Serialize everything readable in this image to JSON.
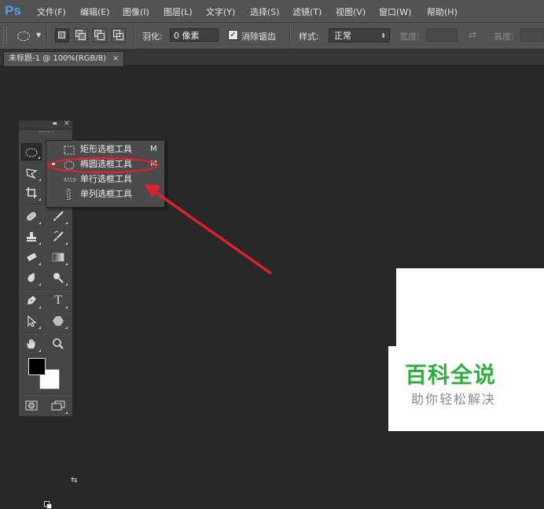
{
  "app": {
    "logo": "Ps"
  },
  "menubar": {
    "items": [
      "文件(F)",
      "编辑(E)",
      "图像(I)",
      "图层(L)",
      "文字(Y)",
      "选择(S)",
      "滤镜(T)",
      "视图(V)",
      "窗口(W)",
      "帮助(H)"
    ]
  },
  "options_bar": {
    "current_tool_icon": "elliptical-marquee-icon",
    "feather_label": "羽化:",
    "feather_value": "0 像素",
    "antialias_label": "消除锯齿",
    "antialias_checked": true,
    "style_label": "样式:",
    "style_value": "正常",
    "width_label": "宽度:",
    "height_label": "高度:",
    "width_value": "",
    "height_value": ""
  },
  "document_tab": {
    "title": "未标题-1 @ 100%(RGB/8)",
    "close": "×"
  },
  "tools_panel": {
    "collapse_icon": "double-chevron-left-icon",
    "close": "×",
    "tools": [
      "elliptical-marquee-icon",
      "polygonal-lasso-icon",
      "crop-icon",
      "spot-healing-brush-icon",
      "brush-icon",
      "clone-stamp-icon",
      "history-brush-icon",
      "eraser-icon",
      "gradient-icon",
      "blur-icon",
      "dodge-icon",
      "pen-icon",
      "type-icon",
      "path-selection-icon",
      "polygon-icon",
      "hand-icon",
      "zoom-icon",
      "quick-mask-icon",
      "screen-mode-icon"
    ],
    "type_tool_glyph": "T",
    "foreground_color": "#000000",
    "background_color": "#ffffff"
  },
  "flyout": {
    "items": [
      {
        "label": "矩形选框工具",
        "key": "M",
        "icon": "rectangular-marquee-icon",
        "selected": false
      },
      {
        "label": "椭圆选框工具",
        "key": "M",
        "icon": "elliptical-marquee-icon",
        "selected": true
      },
      {
        "label": "单行选框工具",
        "key": "",
        "icon": "single-row-marquee-icon",
        "selected": false
      },
      {
        "label": "单列选框工具",
        "key": "",
        "icon": "single-column-marquee-icon",
        "selected": false
      }
    ]
  },
  "annotation": {
    "color": "#e0202e",
    "shapes": [
      "ellipse-highlight",
      "arrow"
    ]
  },
  "watermark": {
    "title": "百科全说",
    "subtitle": "助你轻松解决",
    "title_color": "#2fae3c"
  }
}
